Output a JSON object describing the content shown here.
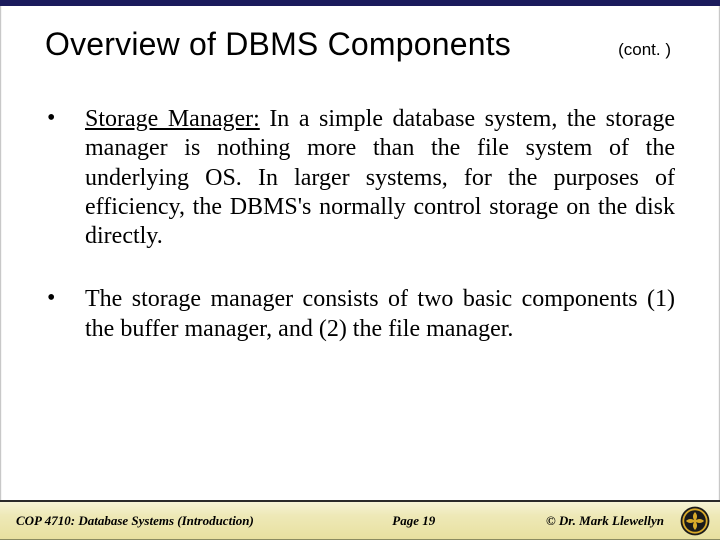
{
  "header": {
    "title": "Overview of DBMS Components",
    "continued": "(cont. )"
  },
  "bullets": [
    {
      "lead": "Storage Manager:",
      "text": " In a simple database system, the storage manager is nothing more than the file system of the underlying OS.  In larger systems, for the purposes of efficiency, the DBMS's normally control storage on the disk directly."
    },
    {
      "lead": "",
      "text": "The storage manager consists of two basic components (1) the buffer manager, and (2) the file manager."
    }
  ],
  "footer": {
    "course": "COP 4710: Database Systems  (Introduction)",
    "page": "Page 19",
    "copyright": "©  Dr. Mark Llewellyn"
  },
  "logo": {
    "name": "ucf-pegasus-seal",
    "gold": "#d8a92a",
    "dark": "#1a1a1a"
  }
}
